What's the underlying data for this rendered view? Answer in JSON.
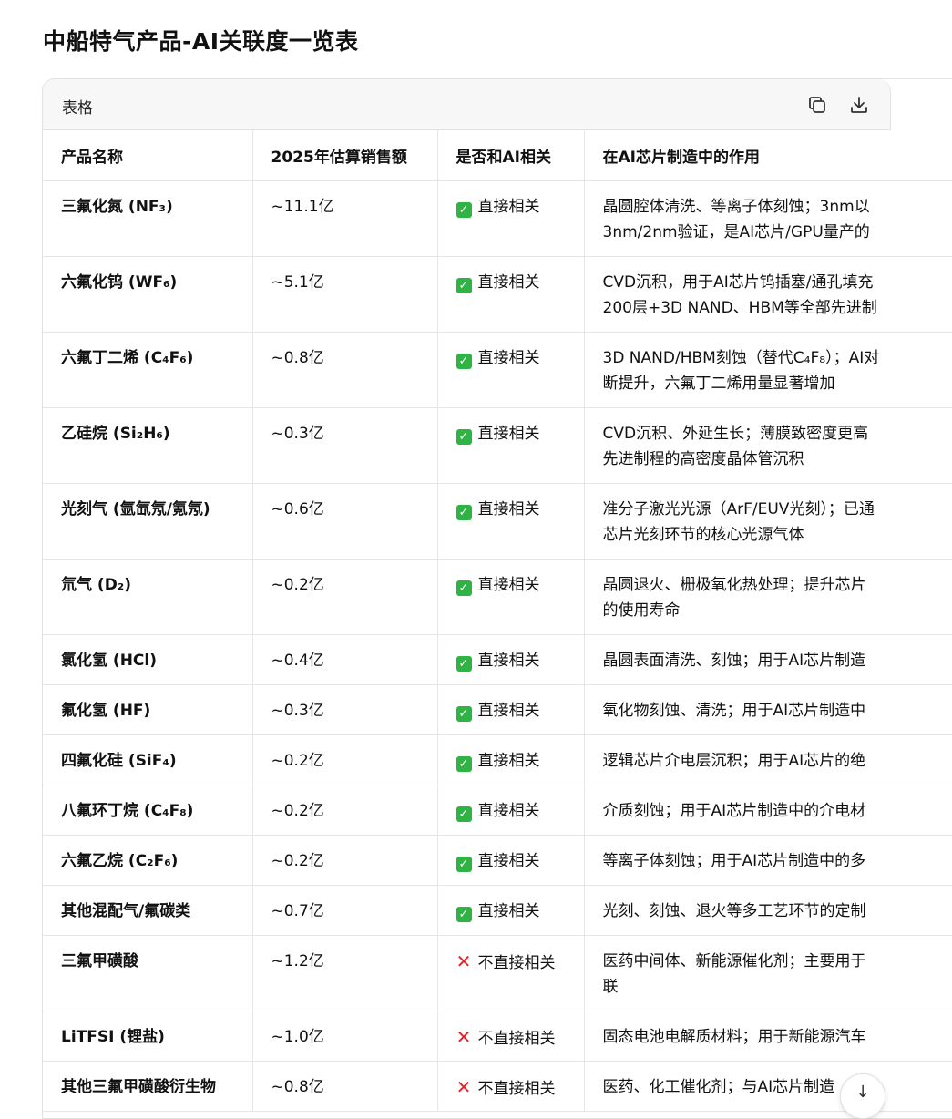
{
  "page": {
    "title": "中船特气产品-AI关联度一览表"
  },
  "card": {
    "title": "表格",
    "icons": [
      "copy-icon",
      "download-icon"
    ]
  },
  "table": {
    "headers": [
      "产品名称",
      "2025年估算销售额",
      "是否和AI相关",
      "在AI芯片制造中的作用"
    ],
    "rows": [
      {
        "name": "三氟化氮 (NF₃)",
        "sales": "~11.1亿",
        "related": true,
        "status": "直接相关",
        "role": [
          "晶圆腔体清洗、等离子体刻蚀；3nm以",
          "3nm/2nm验证，是AI芯片/GPU量产的"
        ]
      },
      {
        "name": "六氟化钨 (WF₆)",
        "sales": "~5.1亿",
        "related": true,
        "status": "直接相关",
        "role": [
          "CVD沉积，用于AI芯片钨插塞/通孔填充",
          "200层+3D NAND、HBM等全部先进制"
        ]
      },
      {
        "name": "六氟丁二烯 (C₄F₆)",
        "sales": "~0.8亿",
        "related": true,
        "status": "直接相关",
        "role": [
          "3D NAND/HBM刻蚀（替代C₄F₈）；AI对",
          "断提升，六氟丁二烯用量显著增加"
        ]
      },
      {
        "name": "乙硅烷 (Si₂H₆)",
        "sales": "~0.3亿",
        "related": true,
        "status": "直接相关",
        "role": [
          "CVD沉积、外延生长；薄膜致密度更高",
          "先进制程的高密度晶体管沉积"
        ]
      },
      {
        "name": "光刻气 (氩氙氖/氪氖)",
        "sales": "~0.6亿",
        "related": true,
        "status": "直接相关",
        "role": [
          "准分子激光光源（ArF/EUV光刻）；已通",
          "芯片光刻环节的核心光源气体"
        ]
      },
      {
        "name": "氘气 (D₂)",
        "sales": "~0.2亿",
        "related": true,
        "status": "直接相关",
        "role": [
          "晶圆退火、栅极氧化热处理；提升芯片",
          "的使用寿命"
        ]
      },
      {
        "name": "氯化氢 (HCl)",
        "sales": "~0.4亿",
        "related": true,
        "status": "直接相关",
        "role": [
          "晶圆表面清洗、刻蚀；用于AI芯片制造"
        ]
      },
      {
        "name": "氟化氢 (HF)",
        "sales": "~0.3亿",
        "related": true,
        "status": "直接相关",
        "role": [
          "氧化物刻蚀、清洗；用于AI芯片制造中"
        ]
      },
      {
        "name": "四氟化硅 (SiF₄)",
        "sales": "~0.2亿",
        "related": true,
        "status": "直接相关",
        "role": [
          "逻辑芯片介电层沉积；用于AI芯片的绝"
        ]
      },
      {
        "name": "八氟环丁烷 (C₄F₈)",
        "sales": "~0.2亿",
        "related": true,
        "status": "直接相关",
        "role": [
          "介质刻蚀；用于AI芯片制造中的介电材"
        ]
      },
      {
        "name": "六氟乙烷 (C₂F₆)",
        "sales": "~0.2亿",
        "related": true,
        "status": "直接相关",
        "role": [
          "等离子体刻蚀；用于AI芯片制造中的多"
        ]
      },
      {
        "name": "其他混配气/氟碳类",
        "sales": "~0.7亿",
        "related": true,
        "status": "直接相关",
        "role": [
          "光刻、刻蚀、退火等多工艺环节的定制"
        ]
      },
      {
        "name": "三氟甲磺酸",
        "sales": "~1.2亿",
        "related": false,
        "status": "不直接相关",
        "role": [
          "医药中间体、新能源催化剂；主要用于",
          "联"
        ]
      },
      {
        "name": "LiTFSI (锂盐)",
        "sales": "~1.0亿",
        "related": false,
        "status": "不直接相关",
        "role": [
          "固态电池电解质材料；用于新能源汽车"
        ]
      },
      {
        "name": "其他三氟甲磺酸衍生物",
        "sales": "~0.8亿",
        "related": false,
        "status": "不直接相关",
        "role": [
          "医药、化工催化剂；与AI芯片制造"
        ]
      }
    ]
  },
  "scroll_button": {
    "icon": "arrow-down-icon",
    "glyph": "↓"
  }
}
